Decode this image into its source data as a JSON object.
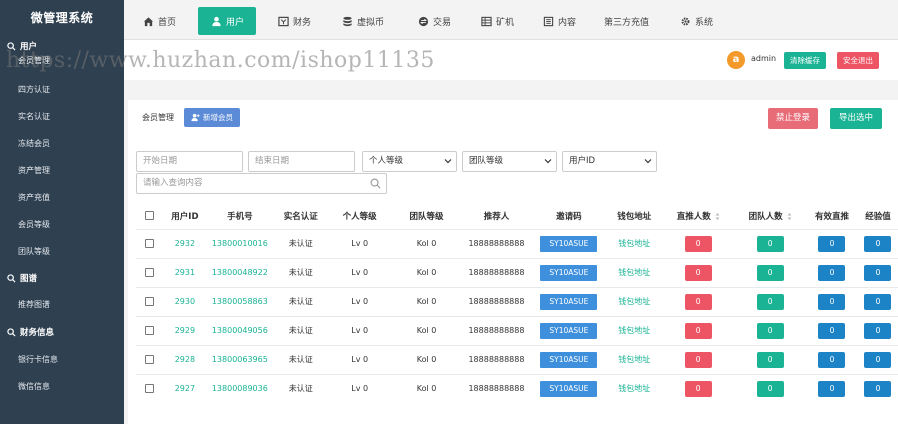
{
  "app": {
    "title": "微管理系统"
  },
  "watermark": "https://www.huzhan.com/ishop11135",
  "sidebar": {
    "groups": [
      {
        "label": "用户",
        "icon": "search-icon",
        "items": [
          "会员管理",
          "四方认证",
          "实名认证",
          "冻结会员",
          "资产管理",
          "资产充值",
          "会员等级",
          "团队等级"
        ]
      },
      {
        "label": "图谱",
        "icon": "search-icon",
        "items": [
          "推荐图谱"
        ]
      },
      {
        "label": "财务信息",
        "icon": "search-icon",
        "items": [
          "银行卡信息",
          "微信信息"
        ]
      }
    ]
  },
  "nav": {
    "tabs": [
      {
        "label": "首页",
        "icon": "home-icon"
      },
      {
        "label": "用户",
        "icon": "user-icon",
        "active": true
      },
      {
        "label": "财务",
        "icon": "finance-icon"
      },
      {
        "label": "虚拟币",
        "icon": "database-icon"
      },
      {
        "label": "交易",
        "icon": "exchange-icon"
      },
      {
        "label": "矿机",
        "icon": "grid-icon"
      },
      {
        "label": "内容",
        "icon": "content-icon"
      },
      {
        "label": "第三方充值",
        "icon": ""
      },
      {
        "label": "系统",
        "icon": "gear-icon"
      }
    ]
  },
  "header": {
    "avatar_letter": "a",
    "username": "admin",
    "clear_cache": "清除缓存",
    "logout": "安全退出"
  },
  "panel": {
    "title": "会员管理",
    "add_member": "新增会员",
    "ban_login": "禁止登录",
    "export_selected": "导出选中"
  },
  "filters": {
    "start_date": "开始日期",
    "end_date": "结束日期",
    "personal_level": "个人等级",
    "team_level": "团队等级",
    "user_id": "用户ID",
    "search_placeholder": "请输入查询内容"
  },
  "table": {
    "columns": [
      "用户ID",
      "手机号",
      "实名认证",
      "个人等级",
      "团队等级",
      "推荐人",
      "邀请码",
      "钱包地址",
      "直推人数",
      "团队人数",
      "有效直推",
      "经验值"
    ],
    "rows": [
      {
        "id": "2932",
        "phone": "13800010016",
        "auth": "未认证",
        "plevel": "Lv 0",
        "tlevel": "Kol 0",
        "referrer": "18888888888",
        "code": "SY10ASUE",
        "wallet": "钱包地址",
        "direct": "0",
        "team": "0",
        "valid": "0",
        "exp": "0"
      },
      {
        "id": "2931",
        "phone": "13800048922",
        "auth": "未认证",
        "plevel": "Lv 0",
        "tlevel": "Kol 0",
        "referrer": "18888888888",
        "code": "SY10ASUE",
        "wallet": "钱包地址",
        "direct": "0",
        "team": "0",
        "valid": "0",
        "exp": "0"
      },
      {
        "id": "2930",
        "phone": "13800058863",
        "auth": "未认证",
        "plevel": "Lv 0",
        "tlevel": "Kol 0",
        "referrer": "18888888888",
        "code": "SY10ASUE",
        "wallet": "钱包地址",
        "direct": "0",
        "team": "0",
        "valid": "0",
        "exp": "0"
      },
      {
        "id": "2929",
        "phone": "13800049056",
        "auth": "未认证",
        "plevel": "Lv 0",
        "tlevel": "Kol 0",
        "referrer": "18888888888",
        "code": "SY10ASUE",
        "wallet": "钱包地址",
        "direct": "0",
        "team": "0",
        "valid": "0",
        "exp": "0"
      },
      {
        "id": "2928",
        "phone": "13800063965",
        "auth": "未认证",
        "plevel": "Lv 0",
        "tlevel": "Kol 0",
        "referrer": "18888888888",
        "code": "SY10ASUE",
        "wallet": "钱包地址",
        "direct": "0",
        "team": "0",
        "valid": "0",
        "exp": "0"
      },
      {
        "id": "2927",
        "phone": "13800089036",
        "auth": "未认证",
        "plevel": "Lv 0",
        "tlevel": "Kol 0",
        "referrer": "18888888888",
        "code": "SY10ASUE",
        "wallet": "钱包地址",
        "direct": "0",
        "team": "0",
        "valid": "0",
        "exp": "0"
      }
    ]
  },
  "colors": {
    "sidebar_bg": "#2f4050",
    "primary": "#1ab394",
    "danger": "#ed5565",
    "info": "#1c84c6",
    "code_bg": "#3e8fdc"
  }
}
